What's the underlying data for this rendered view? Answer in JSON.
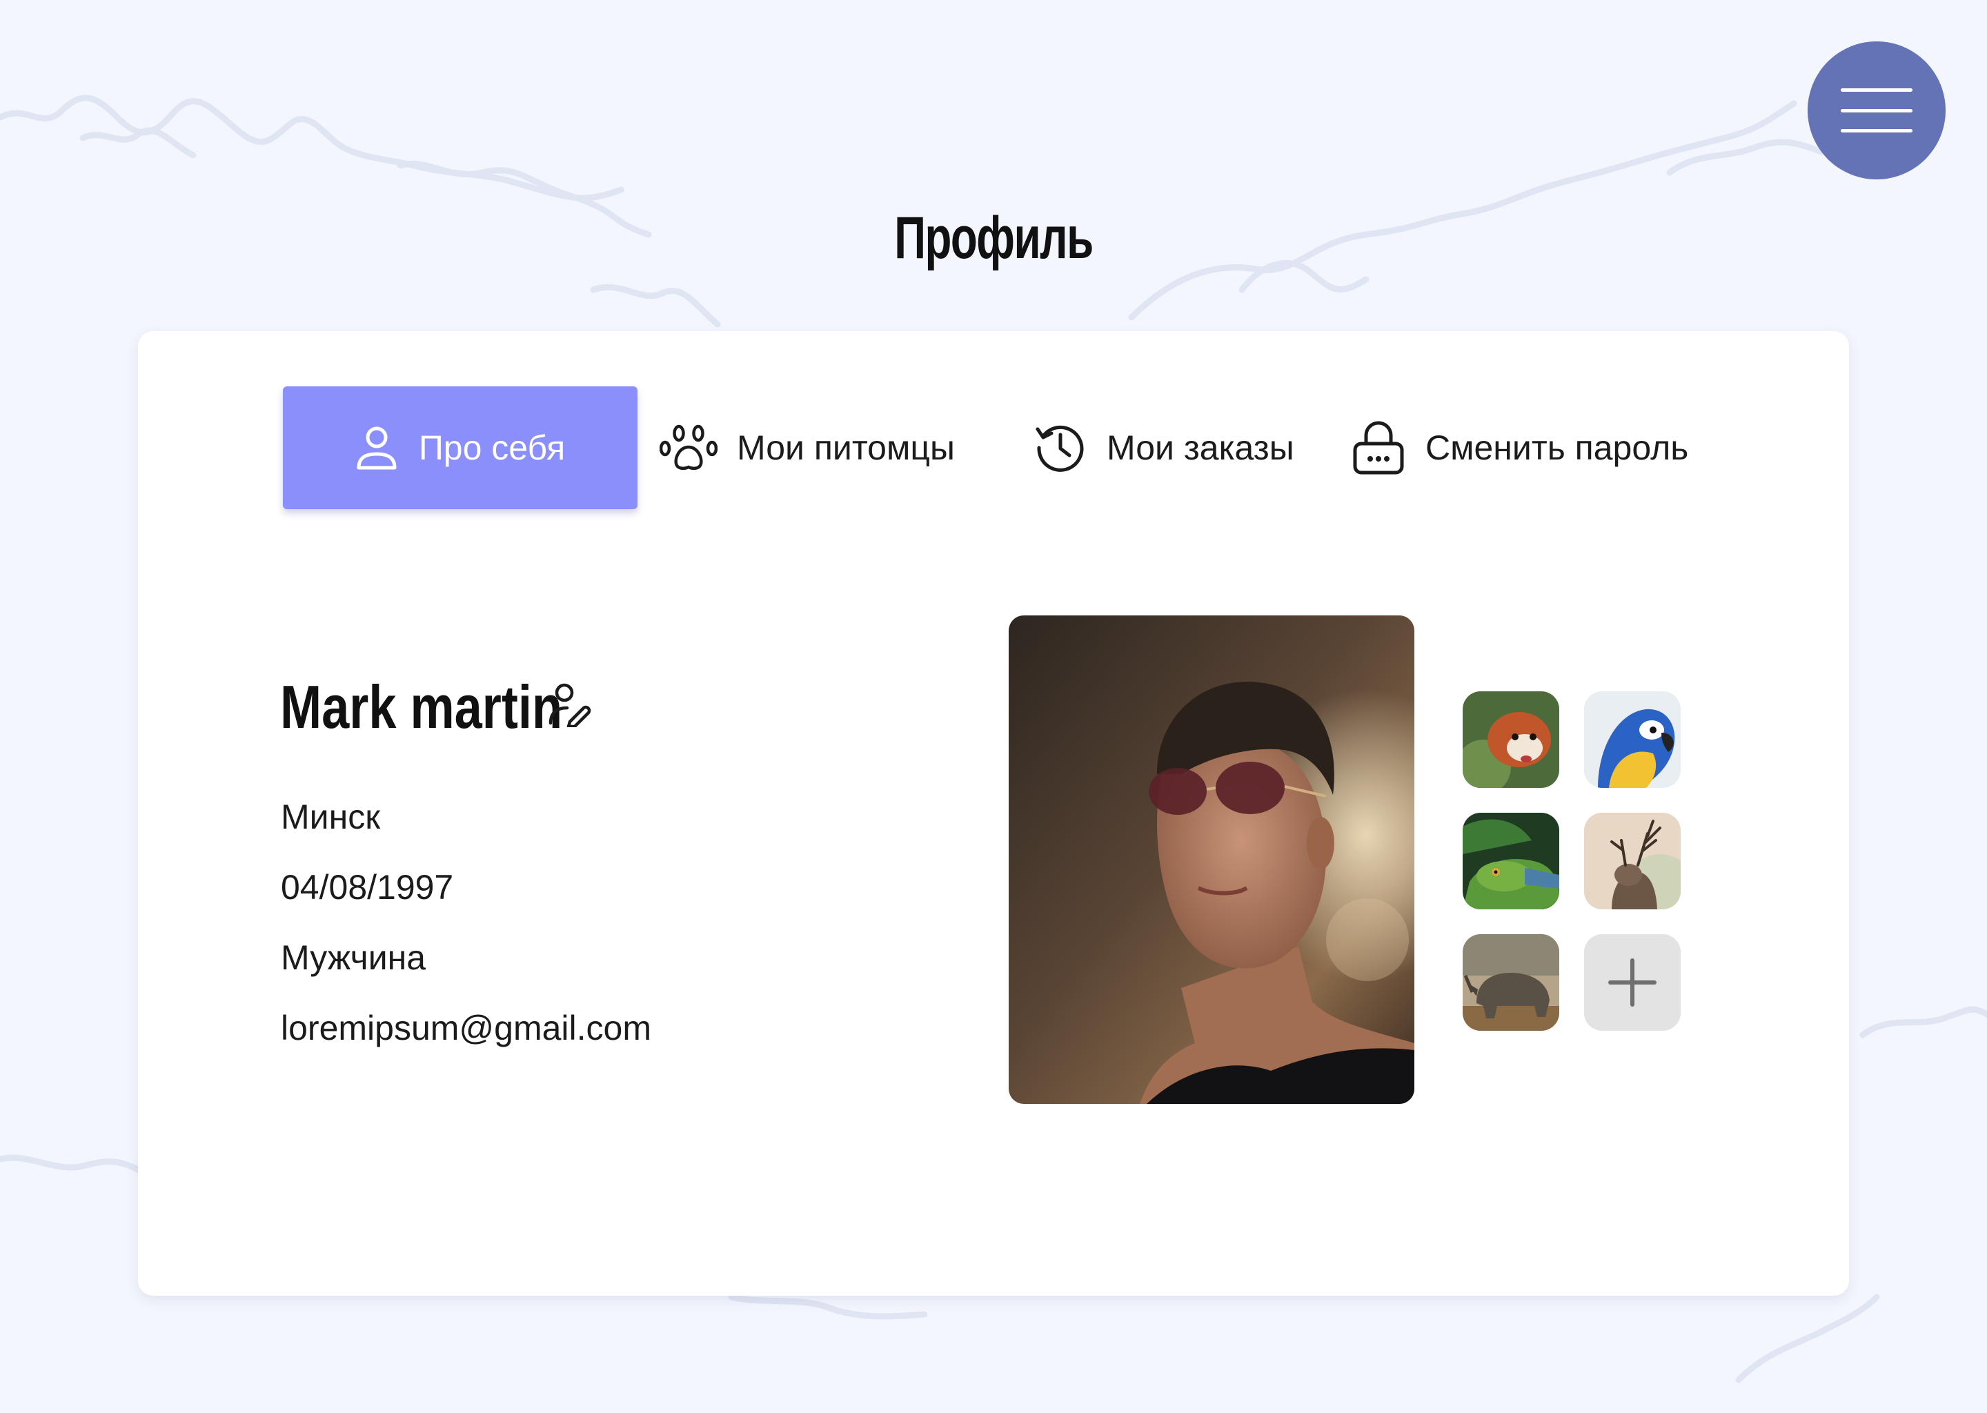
{
  "page": {
    "title": "Профиль"
  },
  "menu": {
    "icon": "hamburger-menu-icon"
  },
  "tabs": [
    {
      "label": "Про себя",
      "icon": "user-icon",
      "active": true
    },
    {
      "label": "Мои питомцы",
      "icon": "paw-icon",
      "active": false
    },
    {
      "label": "Мои заказы",
      "icon": "history-clock-icon",
      "active": false
    },
    {
      "label": "Сменить пароль",
      "icon": "lock-icon",
      "active": false
    }
  ],
  "profile": {
    "name": "Mark martin",
    "city": "Минск",
    "birth_date": "04/08/1997",
    "gender": "Мужчина",
    "email": "loremipsum@gmail.com"
  },
  "gallery": {
    "items": [
      "red-panda",
      "parrot",
      "iguana",
      "deer",
      "rhinoceros"
    ],
    "add_icon": "plus-icon"
  },
  "colors": {
    "background": "#f3f6fd",
    "accent": "#8b8ffb",
    "menu_button": "#6373b6",
    "card": "#ffffff",
    "text": "#111111"
  }
}
